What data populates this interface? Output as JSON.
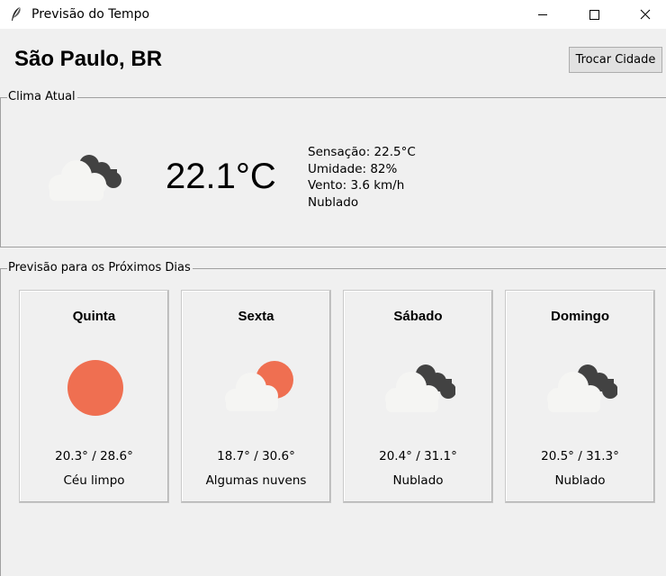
{
  "window": {
    "title": "Previsão do Tempo",
    "icon": "feather-icon"
  },
  "header": {
    "city": "São Paulo, BR",
    "change_city_label": "Trocar Cidade"
  },
  "current": {
    "section_label": "Clima Atual",
    "temperature": "22.1°C",
    "feels_like": "Sensação: 22.5°C",
    "humidity": "Umidade: 82%",
    "wind": "Vento: 3.6 km/h",
    "condition": "Nublado",
    "icon": "cloudy-icon"
  },
  "forecast": {
    "section_label": "Previsão para os Próximos Dias",
    "days": [
      {
        "day": "Quinta",
        "range": "20.3° / 28.6°",
        "desc": "Céu limpo",
        "icon": "sun-icon"
      },
      {
        "day": "Sexta",
        "range": "18.7° / 30.6°",
        "desc": "Algumas nuvens",
        "icon": "partly-cloudy-icon"
      },
      {
        "day": "Sábado",
        "range": "20.4° / 31.1°",
        "desc": "Nublado",
        "icon": "cloudy-icon"
      },
      {
        "day": "Domingo",
        "range": "20.5° / 31.3°",
        "desc": "Nublado",
        "icon": "cloudy-icon"
      }
    ]
  },
  "colors": {
    "sun": "#ef6f51",
    "dark_cloud": "#424242",
    "light_cloud": "#f5f5f3",
    "background": "#f0f0f0"
  }
}
